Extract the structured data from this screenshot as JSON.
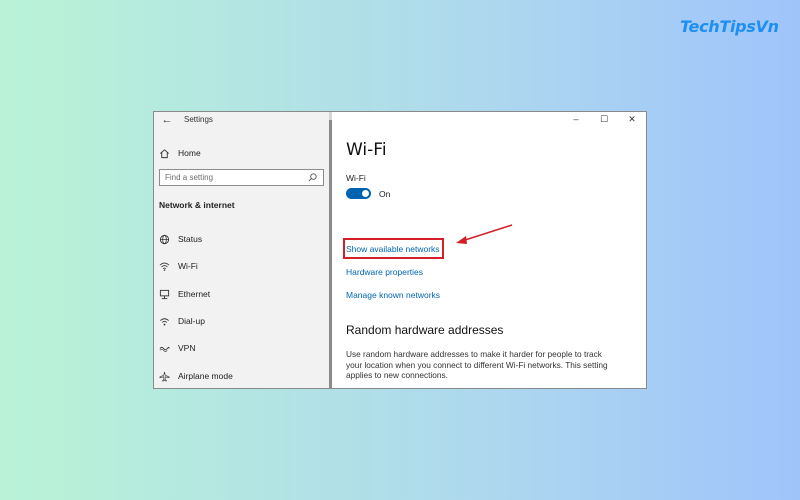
{
  "brand": {
    "text": "TechTipsVn"
  },
  "window": {
    "title": "Settings",
    "controls": {
      "minimize": "–",
      "maximize": "☐",
      "close": "✕"
    }
  },
  "sidebar": {
    "home": "Home",
    "search_placeholder": "Find a setting",
    "section_heading": "Network & internet",
    "items": [
      {
        "label": "Status",
        "icon": "globe-icon"
      },
      {
        "label": "Wi-Fi",
        "icon": "wifi-icon"
      },
      {
        "label": "Ethernet",
        "icon": "ethernet-icon"
      },
      {
        "label": "Dial-up",
        "icon": "dialup-icon"
      },
      {
        "label": "VPN",
        "icon": "vpn-icon"
      },
      {
        "label": "Airplane mode",
        "icon": "airplane-icon"
      }
    ]
  },
  "main": {
    "page_title": "Wi-Fi",
    "wifi_label": "Wi-Fi",
    "toggle_state": "On",
    "links": {
      "show_networks": "Show available networks",
      "hardware_properties": "Hardware properties",
      "manage_known": "Manage known networks"
    },
    "section_title": "Random hardware addresses",
    "description": "Use random hardware addresses to make it harder for people to track your location when you connect to different Wi-Fi networks. This setting applies to new connections."
  },
  "colors": {
    "accent": "#0063b1",
    "link": "#0066b4",
    "highlight": "#d31f25",
    "brand": "#1e8ff0"
  }
}
